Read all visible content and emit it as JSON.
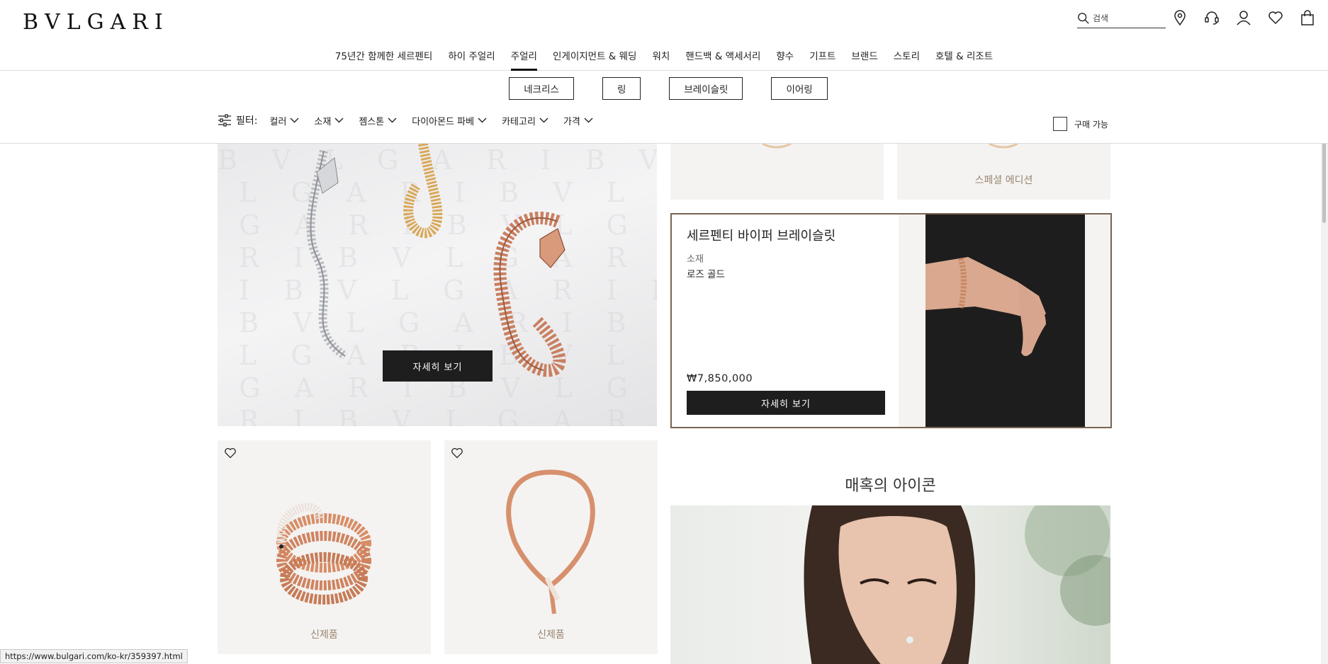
{
  "brand": {
    "logo": "BVLGARI"
  },
  "search": {
    "placeholder": "검색"
  },
  "main_nav": [
    {
      "label": "75년간 함께한 세르펜티"
    },
    {
      "label": "하이 주얼리"
    },
    {
      "label": "주얼리"
    },
    {
      "label": "인게이지먼트 & 웨딩"
    },
    {
      "label": "워치"
    },
    {
      "label": "핸드백 & 액세서리"
    },
    {
      "label": "향수"
    },
    {
      "label": "기프트"
    },
    {
      "label": "브랜드"
    },
    {
      "label": "스토리"
    },
    {
      "label": "호텔 & 리조트"
    }
  ],
  "categories": [
    {
      "label": "네크리스"
    },
    {
      "label": "링"
    },
    {
      "label": "브레이슬릿"
    },
    {
      "label": "이어링"
    }
  ],
  "filters": {
    "label": "필터:",
    "items": [
      {
        "label": "컬러"
      },
      {
        "label": "소재"
      },
      {
        "label": "젬스톤"
      },
      {
        "label": "다이아몬드 파베"
      },
      {
        "label": "카테고리"
      },
      {
        "label": "가격"
      }
    ],
    "availability_label": "구매 가능"
  },
  "hero": {
    "button_label": "자세히 보기"
  },
  "top_cards": [
    {
      "tag": ""
    },
    {
      "tag": "스페셜 에디션"
    }
  ],
  "feature": {
    "title": "세르펜티 바이퍼 브레이슬릿",
    "material_label": "소재",
    "material_value": "로즈 골드",
    "price": "₩7,850,000",
    "button_label": "자세히 보기"
  },
  "products": [
    {
      "tag": "신제품"
    },
    {
      "tag": "신제품"
    }
  ],
  "icon_section": {
    "title": "매혹의 아이콘"
  },
  "status_url": "https://www.bulgari.com/ko-kr/359397.html",
  "colors": {
    "accent_text": "#9a8570",
    "feature_border": "#786450",
    "button_bg": "#1e1e1e",
    "card_bg": "#f4f3f1"
  }
}
